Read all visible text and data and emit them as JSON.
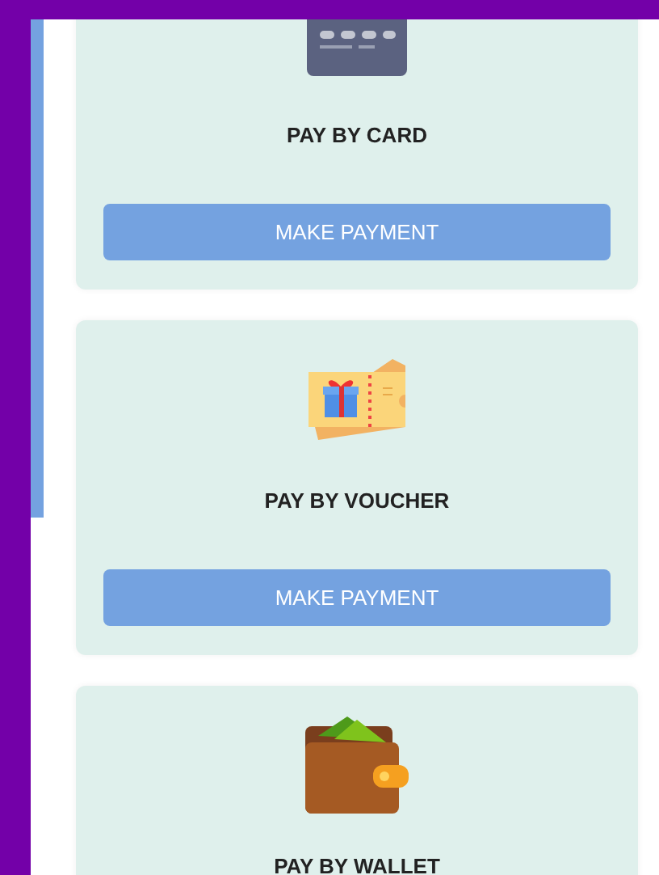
{
  "payment_options": [
    {
      "kind": "card",
      "title": "PAY BY CARD",
      "button": "MAKE PAYMENT"
    },
    {
      "kind": "voucher",
      "title": "PAY BY VOUCHER",
      "button": "MAKE PAYMENT"
    },
    {
      "kind": "wallet",
      "title": "PAY BY WALLET"
    }
  ]
}
